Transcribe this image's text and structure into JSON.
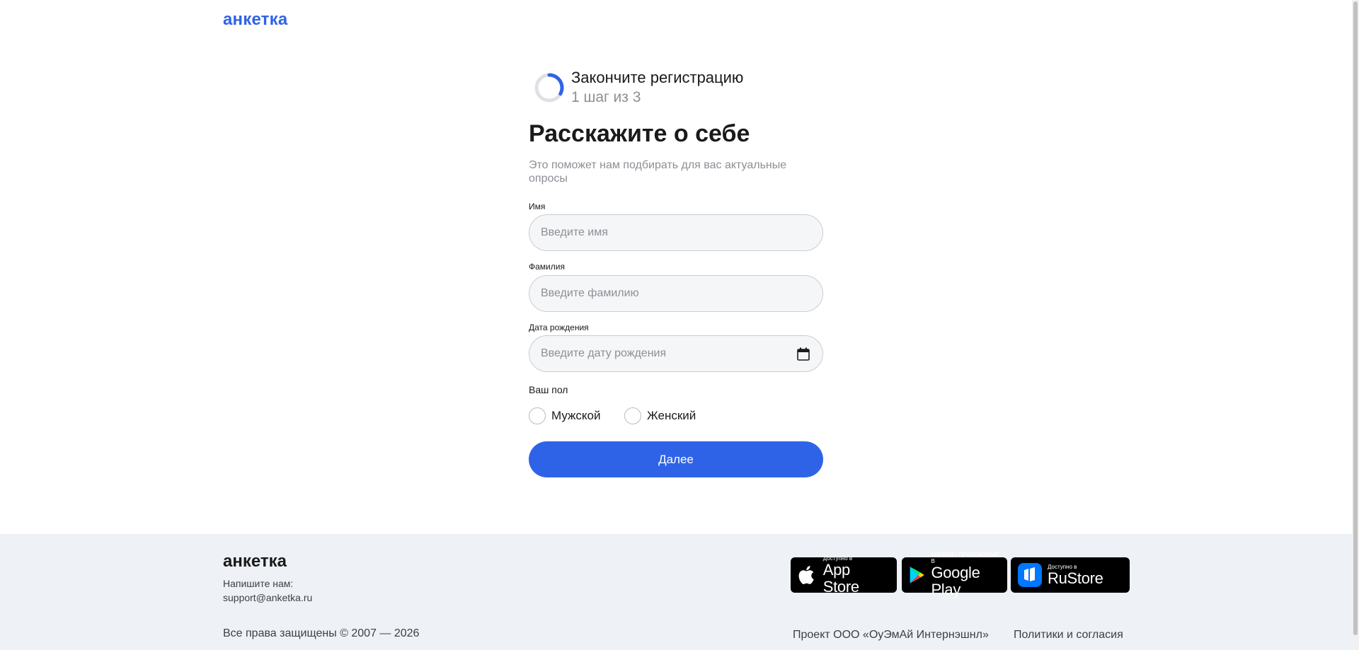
{
  "brand": {
    "logo": "анкетка",
    "accent_color": "#2f63e7"
  },
  "progress": {
    "title": "Закончите регистрацию",
    "step_text": "1 шаг из 3",
    "fraction": 0.33
  },
  "form": {
    "heading": "Расскажите о себе",
    "subtext": "Это поможет нам подбирать для вас актуальные опросы",
    "first_name": {
      "label": "Имя",
      "placeholder": "Введите имя",
      "value": ""
    },
    "last_name": {
      "label": "Фамилия",
      "placeholder": "Введите фамилию",
      "value": ""
    },
    "birth_date": {
      "label": "Дата рождения",
      "placeholder": "Введите дату рождения",
      "value": "",
      "icon": "calendar-icon"
    },
    "gender": {
      "label": "Ваш пол",
      "options": [
        "Мужской",
        "Женский"
      ]
    },
    "submit_label": "Далее"
  },
  "footer": {
    "logo": "анкетка",
    "contact_label": "Напишите нам:",
    "contact_email": "support@anketka.ru",
    "copyright": "Все права защищены © 2007 — 2026",
    "project": "Проект ООО «ОуЭмАй Интернэшнл»",
    "policies": "Политики и согласия",
    "stores": {
      "appstore": {
        "small": "Доступно в",
        "big": "App Store",
        "icon": "apple-icon"
      },
      "googleplay": {
        "small": "ANDROID ПРИЛОЖЕНИЕ В",
        "big": "Google Play",
        "icon": "google-play-icon"
      },
      "rustore": {
        "small": "Доступно в",
        "big": "RuStore",
        "icon": "rustore-icon"
      }
    }
  }
}
